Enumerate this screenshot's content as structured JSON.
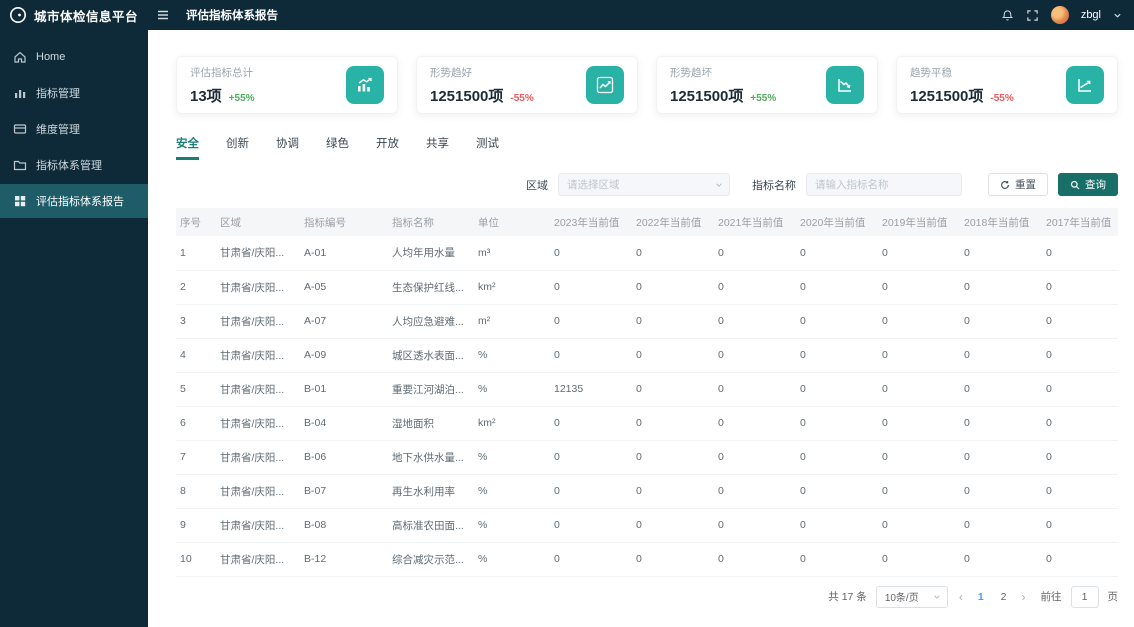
{
  "app": {
    "title": "城市体检信息平台"
  },
  "topbar": {
    "page_tab": "评估指标体系报告",
    "username": "zbgl",
    "icons": [
      "bell-icon",
      "fullscreen-icon",
      "avatar",
      "chevron-down-icon"
    ]
  },
  "sidebar": {
    "items": [
      {
        "label": "Home",
        "icon": "home-icon",
        "active": false
      },
      {
        "label": "指标管理",
        "icon": "bar-chart-icon",
        "active": false
      },
      {
        "label": "维度管理",
        "icon": "card-icon",
        "active": false
      },
      {
        "label": "指标体系管理",
        "icon": "folder-icon",
        "active": false
      },
      {
        "label": "评估指标体系报告",
        "icon": "grid-icon",
        "active": true
      }
    ]
  },
  "stat_cards": [
    {
      "label": "评估指标总计",
      "value": "13项",
      "delta": "+55%",
      "icon": "bar-chart-up-icon"
    },
    {
      "label": "形势趋好",
      "value": "1251500项",
      "delta": "-55%",
      "icon": "line-chart-up-icon"
    },
    {
      "label": "形势趋坏",
      "value": "1251500项",
      "delta": "+55%",
      "icon": "line-chart-down-icon"
    },
    {
      "label": "趋势平稳",
      "value": "1251500项",
      "delta": "-55%",
      "icon": "line-chart-steady-icon"
    }
  ],
  "colors": {
    "sidebar_bg": "#0e2a39",
    "sidebar_active_bg": "#1e5d68",
    "accent_teal": "#29b3a6",
    "button_teal": "#176f68",
    "tab_active_teal": "#1a7e76",
    "delta_up_green": "#4fae5c",
    "delta_down_red": "#e45a5a",
    "active_page_blue": "#409eff"
  },
  "tabs": {
    "items": [
      "安全",
      "创新",
      "协调",
      "绿色",
      "开放",
      "共享",
      "测试"
    ],
    "active": "安全"
  },
  "filters": {
    "region_label": "区域",
    "region_placeholder": "请选择区域",
    "indicator_label": "指标名称",
    "indicator_placeholder": "请输入指标名称",
    "reset_label": "重置",
    "search_label": "查询"
  },
  "table": {
    "headers": [
      "序号",
      "区域",
      "指标编号",
      "指标名称",
      "单位",
      "2023年当前值",
      "2022年当前值",
      "2021年当前值",
      "2020年当前值",
      "2019年当前值",
      "2018年当前值",
      "2017年当前值"
    ],
    "rows": [
      [
        "1",
        "甘肃省/庆阳...",
        "A-01",
        "人均年用水量",
        "m³",
        "0",
        "0",
        "0",
        "0",
        "0",
        "0",
        "0"
      ],
      [
        "2",
        "甘肃省/庆阳...",
        "A-05",
        "生态保护红线...",
        "km²",
        "0",
        "0",
        "0",
        "0",
        "0",
        "0",
        "0"
      ],
      [
        "3",
        "甘肃省/庆阳...",
        "A-07",
        "人均应急避难...",
        "m²",
        "0",
        "0",
        "0",
        "0",
        "0",
        "0",
        "0"
      ],
      [
        "4",
        "甘肃省/庆阳...",
        "A-09",
        "城区透水表面...",
        "%",
        "0",
        "0",
        "0",
        "0",
        "0",
        "0",
        "0"
      ],
      [
        "5",
        "甘肃省/庆阳...",
        "B-01",
        "重要江河湖泊...",
        "%",
        "12135",
        "0",
        "0",
        "0",
        "0",
        "0",
        "0"
      ],
      [
        "6",
        "甘肃省/庆阳...",
        "B-04",
        "湿地面积",
        "km²",
        "0",
        "0",
        "0",
        "0",
        "0",
        "0",
        "0"
      ],
      [
        "7",
        "甘肃省/庆阳...",
        "B-06",
        "地下水供水量...",
        "%",
        "0",
        "0",
        "0",
        "0",
        "0",
        "0",
        "0"
      ],
      [
        "8",
        "甘肃省/庆阳...",
        "B-07",
        "再生水利用率",
        "%",
        "0",
        "0",
        "0",
        "0",
        "0",
        "0",
        "0"
      ],
      [
        "9",
        "甘肃省/庆阳...",
        "B-08",
        "高标准农田面...",
        "%",
        "0",
        "0",
        "0",
        "0",
        "0",
        "0",
        "0"
      ],
      [
        "10",
        "甘肃省/庆阳...",
        "B-12",
        "综合减灾示范...",
        "%",
        "0",
        "0",
        "0",
        "0",
        "0",
        "0",
        "0"
      ]
    ]
  },
  "pagination": {
    "total": "共 17 条",
    "page_size": "10条/页",
    "prev": "‹",
    "next": "›",
    "pages": [
      "1",
      "2"
    ],
    "active_page": "1",
    "goto_label": "前往",
    "goto_value": "1",
    "page_suffix": "页"
  }
}
